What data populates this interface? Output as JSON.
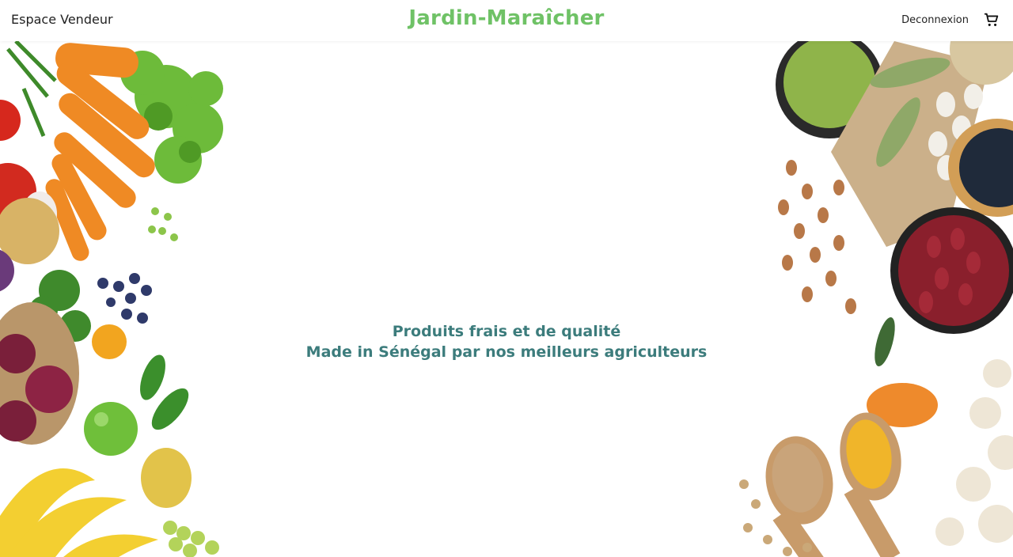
{
  "nav": {
    "left_label": "Espace Vendeur",
    "brand": "Jardin-Maraîcher",
    "logout_label": "Deconnexion",
    "cart_icon": "shopping-cart-icon"
  },
  "hero": {
    "line1": "Produits frais et de qualité",
    "line2": "Made in Sénégal par nos meilleurs agriculteurs"
  },
  "colors": {
    "brand": "#6fc266",
    "tagline": "#3c7c7c",
    "background": "#ffffff"
  }
}
